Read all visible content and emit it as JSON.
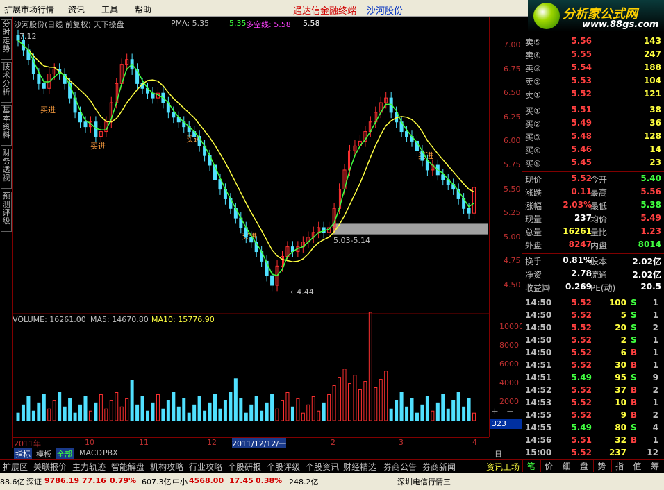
{
  "menu": {
    "items": [
      "扩展市场行情",
      "资讯",
      "工具",
      "帮助"
    ],
    "red_title": "通达信金融终端",
    "stock": "沙河股份"
  },
  "logo": {
    "name": "分析家公式网",
    "url": "www.88gs.com"
  },
  "left_tabs": [
    "分时走势",
    "技术分析",
    "基本资料",
    "财务透视",
    "预测评级"
  ],
  "chart": {
    "title": "沙河股份(日线 前复权) 天下操盘",
    "pma_label": "PMA: 5.35",
    "pma_val2": "5.35",
    "dk_label": "多空线: 5.58",
    "dk_val2": "5.58",
    "corner_price": "7.12",
    "buy_label": "买进",
    "low_label": "←4.44",
    "range_label": "5.03-5.14",
    "volume_header": "VOLUME: 16261.00",
    "ma5": "MA5: 14670.80",
    "ma10": "MA10: 15776.90",
    "vol_current": "323"
  },
  "chart_data": {
    "type": "candlestick",
    "y_ticks": [
      "7.00",
      "6.75",
      "6.50",
      "6.25",
      "6.00",
      "5.75",
      "5.50",
      "5.25",
      "5.00",
      "4.75",
      "4.50"
    ],
    "vol_ticks": [
      "10000",
      "8000",
      "6000",
      "4000",
      "2000"
    ],
    "date_labels": [
      "2011年",
      "10",
      "11",
      "12",
      "2011/12/12/一",
      "2",
      "3",
      "4"
    ]
  },
  "bottom_tabs": [
    "指标",
    "模板",
    "全部",
    "MACD",
    "PBX"
  ],
  "timeframe": "日线",
  "quote": {
    "asks": [
      {
        "l": "卖⑤",
        "p": "5.56",
        "v": "143"
      },
      {
        "l": "卖④",
        "p": "5.55",
        "v": "247"
      },
      {
        "l": "卖③",
        "p": "5.54",
        "v": "188"
      },
      {
        "l": "卖②",
        "p": "5.53",
        "v": "104"
      },
      {
        "l": "卖①",
        "p": "5.52",
        "v": "121"
      }
    ],
    "bids": [
      {
        "l": "买①",
        "p": "5.51",
        "v": "38"
      },
      {
        "l": "买②",
        "p": "5.49",
        "v": "36"
      },
      {
        "l": "买③",
        "p": "5.48",
        "v": "128"
      },
      {
        "l": "买④",
        "p": "5.46",
        "v": "14"
      },
      {
        "l": "买⑤",
        "p": "5.45",
        "v": "23"
      }
    ],
    "stats": [
      {
        "l1": "现价",
        "v1": "5.52",
        "c1": "#ff4040",
        "l2": "今开",
        "v2": "5.40",
        "c2": "#40ff40"
      },
      {
        "l1": "涨跌",
        "v1": "0.11",
        "c1": "#ff4040",
        "l2": "最高",
        "v2": "5.56",
        "c2": "#ff4040"
      },
      {
        "l1": "涨幅",
        "v1": "2.03%",
        "c1": "#ff4040",
        "l2": "最低",
        "v2": "5.38",
        "c2": "#40ff40"
      },
      {
        "l1": "现量",
        "v1": "237",
        "c1": "#ffffff",
        "l2": "均价",
        "v2": "5.49",
        "c2": "#ff4040"
      },
      {
        "l1": "总量",
        "v1": "16261",
        "c1": "#ffff40",
        "l2": "量比",
        "v2": "1.23",
        "c2": "#ff4040"
      },
      {
        "l1": "外盘",
        "v1": "8247",
        "c1": "#ff4040",
        "l2": "内盘",
        "v2": "8014",
        "c2": "#40ff40"
      }
    ],
    "stats2": [
      {
        "l1": "换手",
        "v1": "0.81%",
        "l2": "股本",
        "v2": "2.02亿"
      },
      {
        "l1": "净资",
        "v1": "2.78",
        "l2": "流通",
        "v2": "2.02亿"
      },
      {
        "l1": "收益㈣",
        "v1": "0.269",
        "l2": "PE(动)",
        "v2": "20.5"
      }
    ],
    "trades": [
      {
        "t": "14:50",
        "p": "5.52",
        "v": "100",
        "s": "S",
        "n": "1"
      },
      {
        "t": "14:50",
        "p": "5.52",
        "v": "5",
        "s": "S",
        "n": "1"
      },
      {
        "t": "14:50",
        "p": "5.52",
        "v": "20",
        "s": "S",
        "n": "2"
      },
      {
        "t": "14:50",
        "p": "5.52",
        "v": "2",
        "s": "S",
        "n": "1"
      },
      {
        "t": "14:50",
        "p": "5.52",
        "v": "6",
        "s": "B",
        "n": "1"
      },
      {
        "t": "14:51",
        "p": "5.52",
        "v": "30",
        "s": "B",
        "n": "1"
      },
      {
        "t": "14:51",
        "p": "5.49",
        "v": "95",
        "s": "S",
        "n": "9"
      },
      {
        "t": "14:52",
        "p": "5.52",
        "v": "37",
        "s": "B",
        "n": "2"
      },
      {
        "t": "14:53",
        "p": "5.52",
        "v": "10",
        "s": "B",
        "n": "1"
      },
      {
        "t": "14:55",
        "p": "5.52",
        "v": "9",
        "s": "B",
        "n": "2"
      },
      {
        "t": "14:55",
        "p": "5.49",
        "v": "80",
        "s": "S",
        "n": "4"
      },
      {
        "t": "14:56",
        "p": "5.51",
        "v": "32",
        "s": "B",
        "n": "1"
      },
      {
        "t": "15:00",
        "p": "5.52",
        "v": "237",
        "s": "",
        "n": "12"
      }
    ]
  },
  "nav_tabs": [
    "扩展区",
    "关联报价",
    "主力轨迹",
    "智能解盘",
    "机构攻略",
    "行业攻略",
    "个股研报",
    "个股评级",
    "个股资讯",
    "财经精选",
    "券商公告",
    "券商新闻",
    "资讯工场"
  ],
  "right_tabs": [
    "笔",
    "价",
    "细",
    "盘",
    "势",
    "指",
    "值",
    "筹"
  ],
  "status": {
    "s1": "88.6亿",
    "s2": "深证",
    "s3": "9786.19",
    "s4": "77.16",
    "s5": "0.79%",
    "s6": "607.3亿",
    "s7": "中小",
    "s8": "4568.00",
    "s9": "17.45",
    "s10": "0.38%",
    "s11": "248.2亿",
    "s12": "深圳电信行情三"
  }
}
